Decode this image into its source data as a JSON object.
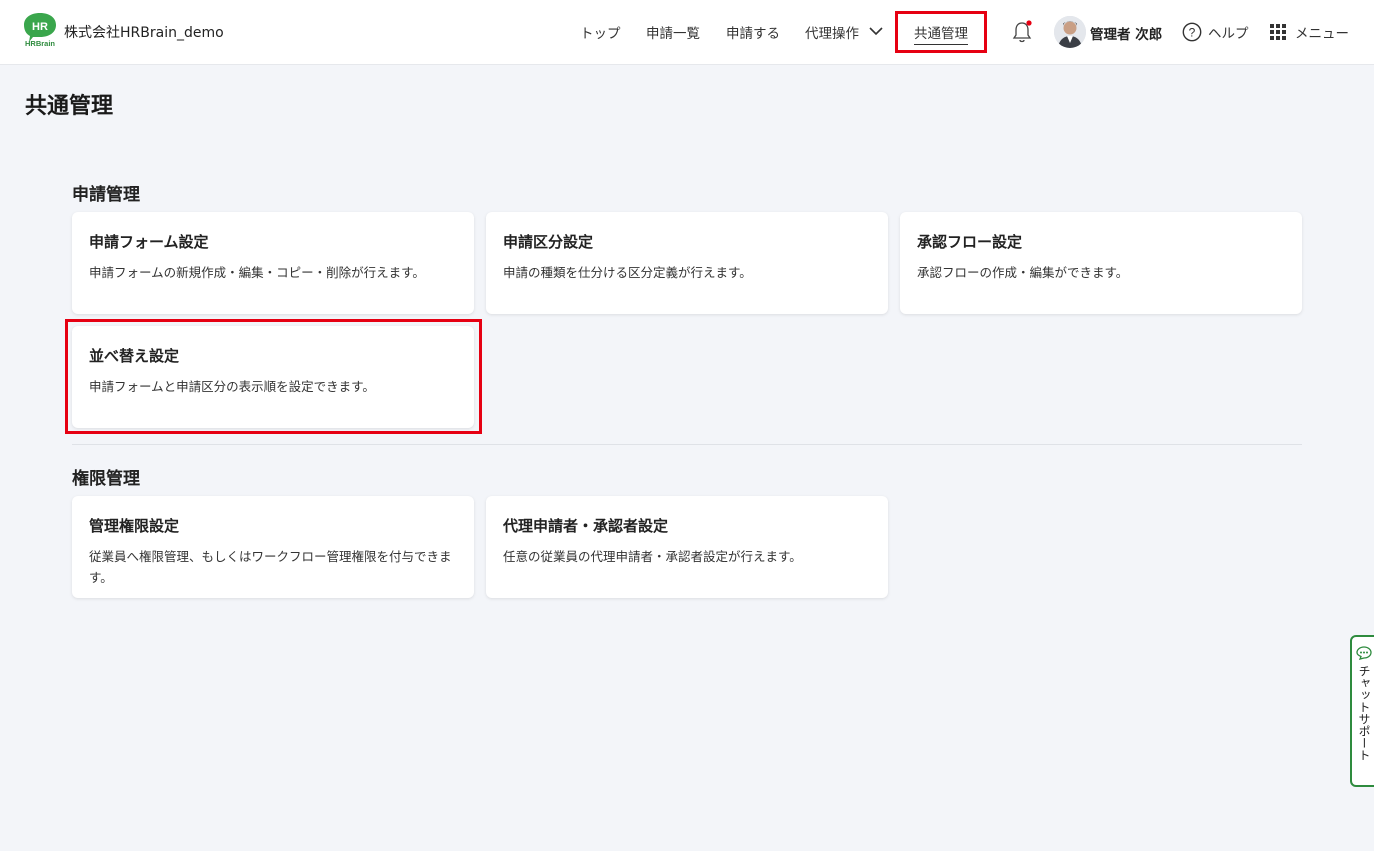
{
  "header": {
    "logo_text": "HR",
    "logo_subtext": "HRBrain",
    "company_name": "株式会社HRBrain_demo",
    "nav": {
      "top": "トップ",
      "list": "申請一覧",
      "apply": "申請する",
      "proxy": "代理操作",
      "common": "共通管理"
    },
    "user_name": "管理者 次郎",
    "help_label": "ヘルプ",
    "menu_label": "メニュー",
    "notification_dot_color": "#e60012",
    "accent_color": "#2e8b3e"
  },
  "page": {
    "title": "共通管理"
  },
  "sections": [
    {
      "title": "申請管理",
      "cards": [
        {
          "title": "申請フォーム設定",
          "desc": "申請フォームの新規作成・編集・コピー・削除が行えます。"
        },
        {
          "title": "申請区分設定",
          "desc": "申請の種類を仕分ける区分定義が行えます。"
        },
        {
          "title": "承認フロー設定",
          "desc": "承認フローの作成・編集ができます。"
        },
        {
          "title": "並べ替え設定",
          "desc": "申請フォームと申請区分の表示順を設定できます。"
        }
      ]
    },
    {
      "title": "権限管理",
      "cards": [
        {
          "title": "管理権限設定",
          "desc": "従業員へ権限管理、もしくはワークフロー管理権限を付与できます。"
        },
        {
          "title": "代理申請者・承認者設定",
          "desc": "任意の従業員の代理申請者・承認者設定が行えます。"
        }
      ]
    }
  ],
  "chat_support": {
    "label": "チャットサポート"
  }
}
